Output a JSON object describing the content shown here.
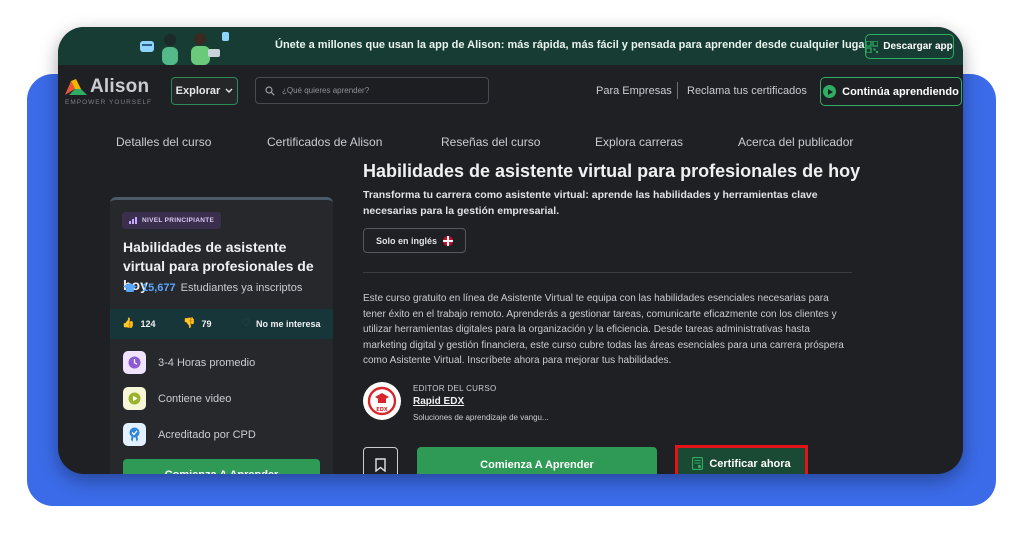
{
  "promo": {
    "text": "Únete a millones que usan la app de Alison: más rápida, más fácil y pensada para aprender desde cualquier lugar",
    "download_label": "Descargar app"
  },
  "header": {
    "logo_name": "Alison",
    "logo_tagline": "EMPOWER YOURSELF",
    "explore_label": "Explorar",
    "search_placeholder": "¿Qué quieres aprender?",
    "link_business": "Para Empresas",
    "link_certificates": "Reclama tus certificados",
    "continue_label": "Continúa aprendiendo"
  },
  "tabs": [
    {
      "label": "Detalles del curso"
    },
    {
      "label": "Certificados de Alison"
    },
    {
      "label": "Reseñas del curso"
    },
    {
      "label": "Explora carreras"
    },
    {
      "label": "Acerca del publicador"
    }
  ],
  "card": {
    "level": "NIVEL PRINCIPIANTE",
    "title": "Habilidades de asistente virtual para profesionales de hoy",
    "enrolled_count": "15,677",
    "enrolled_text": "Estudiantes ya inscriptos",
    "likes": "124",
    "dislikes": "79",
    "not_interested": "No me interesa",
    "features": [
      {
        "label": "3-4 Horas promedio",
        "icon": "clock-icon"
      },
      {
        "label": "Contiene video",
        "icon": "video-icon"
      },
      {
        "label": "Acreditado por CPD",
        "icon": "certified-badge-icon"
      }
    ],
    "start_label": "Comienza A Aprender"
  },
  "main": {
    "title": "Habilidades de asistente virtual para profesionales de hoy",
    "subtitle": "Transforma tu carrera como asistente virtual: aprende las habilidades y herramientas clave necesarias para la gestión empresarial.",
    "language_badge": "Solo en inglés",
    "description": "Este curso gratuito en línea de Asistente Virtual te equipa con las habilidades esenciales necesarias para tener éxito en el trabajo remoto. Aprenderás a gestionar tareas, comunicarte eficazmente con los clientes y utilizar herramientas digitales para la organización y la eficiencia. Desde tareas administrativas hasta marketing digital y gestión financiera, este curso cubre todas las áreas esenciales para una carrera próspera como Asistente Virtual. Inscríbete ahora para mejorar tus habilidades.",
    "publisher_label": "EDITOR DEL CURSO",
    "publisher_name": "Rapid EDX",
    "publisher_tagline": "Soluciones de aprendizaje de vangu...",
    "start_label": "Comienza A Aprender",
    "certify_label": "Certificar ahora"
  },
  "colors": {
    "accent_green": "#2e9a55",
    "highlight_red": "#e2141a",
    "frame_blue": "#3b6be8",
    "link_blue": "#5aa7ff"
  }
}
